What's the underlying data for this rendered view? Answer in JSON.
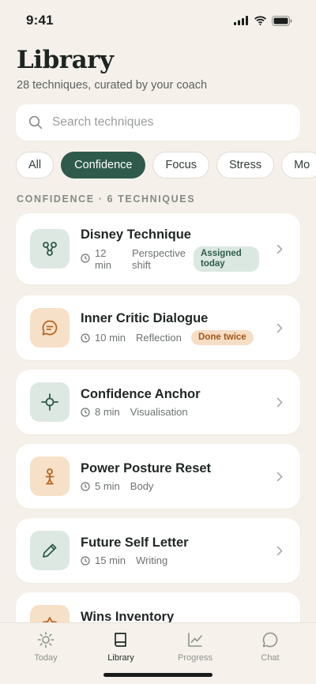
{
  "status_bar": {
    "time": "9:41"
  },
  "header": {
    "title": "Library",
    "subtitle": "28 techniques, curated by your coach"
  },
  "search": {
    "placeholder": "Search techniques",
    "value": ""
  },
  "filters": [
    "All",
    "Confidence",
    "Focus",
    "Stress",
    "Mo"
  ],
  "active_filter": "Confidence",
  "section_label": "CONFIDENCE · 6 TECHNIQUES",
  "techniques": [
    {
      "title": "Disney Technique",
      "duration": "12 min",
      "category": "Perspective shift",
      "badge": "Assigned today",
      "badge_tone": "green",
      "tile_tone": "green",
      "icon": "nodes-icon"
    },
    {
      "title": "Inner Critic Dialogue",
      "duration": "10 min",
      "category": "Reflection",
      "badge": "Done twice",
      "badge_tone": "peach",
      "tile_tone": "peach",
      "icon": "chat-bubble-icon"
    },
    {
      "title": "Confidence Anchor",
      "duration": "8 min",
      "category": "Visualisation",
      "badge": "",
      "tile_tone": "green",
      "icon": "crosshair-icon"
    },
    {
      "title": "Power Posture Reset",
      "duration": "5 min",
      "category": "Body",
      "badge": "",
      "tile_tone": "peach",
      "icon": "person-icon"
    },
    {
      "title": "Future Self Letter",
      "duration": "15 min",
      "category": "Writing",
      "badge": "",
      "tile_tone": "green",
      "icon": "pen-icon"
    },
    {
      "title": "Wins Inventory",
      "duration": "",
      "category": "",
      "badge": "",
      "tile_tone": "peach",
      "icon": "trophy-icon"
    }
  ],
  "tabs": [
    {
      "label": "Today",
      "icon": "sun-icon"
    },
    {
      "label": "Library",
      "icon": "book-icon"
    },
    {
      "label": "Progress",
      "icon": "chart-icon"
    },
    {
      "label": "Chat",
      "icon": "chat-icon"
    }
  ],
  "active_tab": "Library",
  "colors": {
    "accent": "#2e5a4c",
    "background": "#f5f1ea",
    "peach": "#f6e0c8",
    "sage": "#dde8e2"
  }
}
